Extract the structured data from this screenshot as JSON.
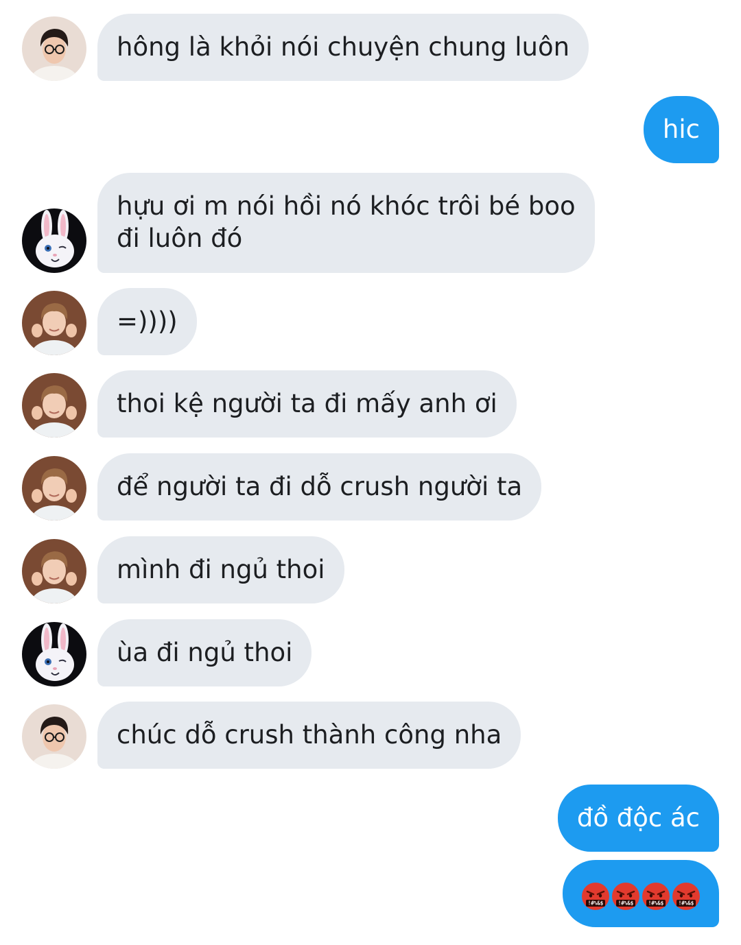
{
  "messages": [
    {
      "text": "hông là khỏi nói chuyện chung luôn",
      "sender": "glasses-guy"
    },
    {
      "text": "hic",
      "sender": "me"
    },
    {
      "text": "hựu ơi m nói hồi nó khóc trôi bé boo",
      "text2": "đi luôn đó",
      "sender": "bunny"
    },
    {
      "text": "=))))",
      "sender": "heart-guy"
    },
    {
      "text": "thoi kệ người ta đi mấy anh ơi",
      "sender": "heart-guy"
    },
    {
      "text": "để người ta đi dỗ crush người ta",
      "sender": "heart-guy"
    },
    {
      "text": "mình đi ngủ thoi",
      "sender": "heart-guy"
    },
    {
      "text": "ùa đi ngủ thoi",
      "sender": "bunny"
    },
    {
      "text": "chúc dỗ crush thành công nha",
      "sender": "glasses-guy"
    },
    {
      "text": "đồ độc ác",
      "sender": "me"
    }
  ],
  "emoji_message": {
    "emojis": [
      "face-with-symbols-on-mouth",
      "face-with-symbols-on-mouth",
      "face-with-symbols-on-mouth",
      "face-with-symbols-on-mouth"
    ],
    "symbol_text": "!#%&$"
  },
  "colors": {
    "incoming_bubble": "#e6eaef",
    "outgoing_bubble": "#1d9bf0",
    "text": "#1c1e21"
  }
}
